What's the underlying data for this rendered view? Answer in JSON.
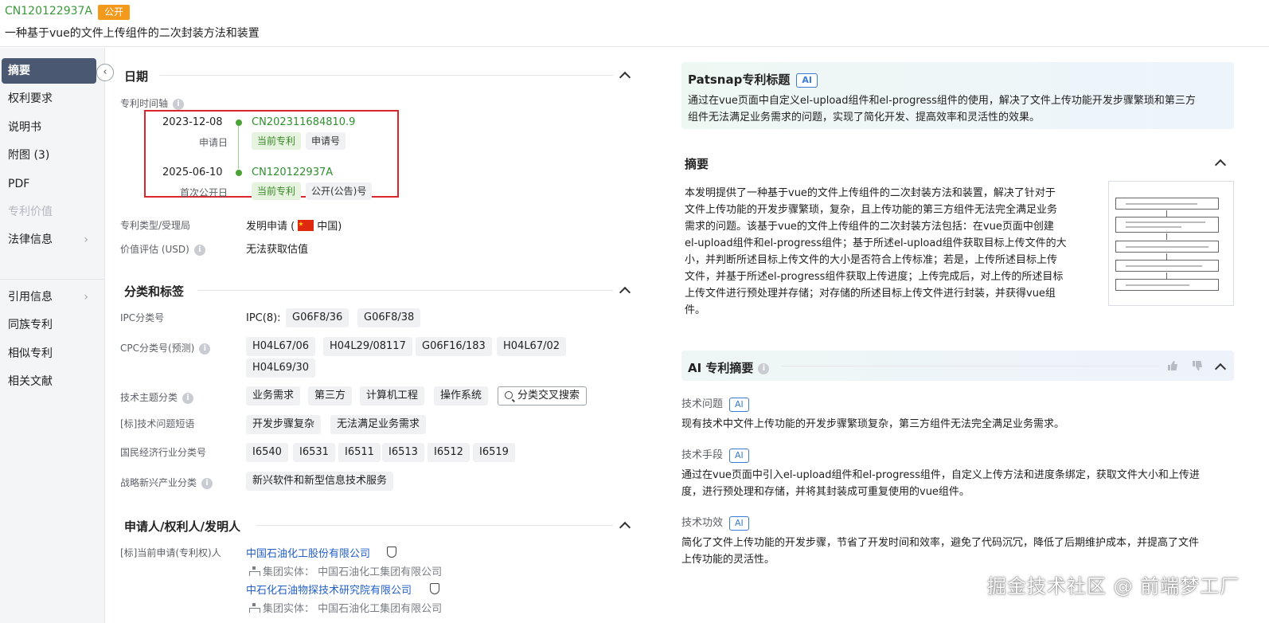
{
  "header": {
    "pub_no": "CN120122937A",
    "status_badge": "公开",
    "title": "一种基于vue的文件上传组件的二次封装方法和装置"
  },
  "sidebar": {
    "items": [
      {
        "label": "摘要",
        "state": "active"
      },
      {
        "label": "权利要求"
      },
      {
        "label": "说明书"
      },
      {
        "label": "附图 (3)"
      },
      {
        "label": "PDF"
      },
      {
        "label": "专利价值",
        "state": "disabled"
      },
      {
        "label": "法律信息",
        "has_arrow": true
      },
      {
        "label": "引用信息",
        "has_arrow": true
      },
      {
        "label": "同族专利"
      },
      {
        "label": "相似专利"
      },
      {
        "label": "相关文献"
      }
    ],
    "chevron": "›",
    "collapse_glyph": "‹"
  },
  "dates": {
    "section_title": "日期",
    "timeline_label": "专利时间轴",
    "entries": [
      {
        "date": "2023-12-08",
        "sub": "申请日",
        "number": "CN202311684810.9",
        "tag1": "当前专利",
        "tag2": "申请号"
      },
      {
        "date": "2025-06-10",
        "sub": "首次公开日",
        "number": "CN120122937A",
        "tag1": "当前专利",
        "tag2": "公开(公告)号"
      }
    ],
    "type_label": "专利类型/受理局",
    "type_value": "发明申请 (",
    "country": "中国)",
    "valuation_label": "价值评估 (USD)",
    "valuation_value": "无法获取估值"
  },
  "classification": {
    "section_title": "分类和标签",
    "ipc_label": "IPC分类号",
    "ipc_prefix": "IPC(8):",
    "ipc_tags": [
      "G06F8/36",
      "G06F8/38"
    ],
    "cpc_label": "CPC分类号(预测)",
    "cpc_tags": [
      "H04L67/06",
      "H04L29/08117",
      "G06F16/183",
      "H04L67/02",
      "H04L69/30"
    ],
    "topic_label": "技术主题分类",
    "topic_tags": [
      "业务需求",
      "第三方",
      "计算机工程",
      "操作系统"
    ],
    "cross_search": "分类交叉搜索",
    "problem_label": "[标]技术问题短语",
    "problem_tags": [
      "开发步骤复杂",
      "无法满足业务需求"
    ],
    "industry_label": "国民经济行业分类号",
    "industry_tags": [
      "I6540",
      "I6531",
      "I6511",
      "I6513",
      "I6512",
      "I6519"
    ],
    "strategic_label": "战略新兴产业分类",
    "strategic_tags": [
      "新兴软件和新型信息技术服务"
    ]
  },
  "applicants": {
    "section_title": "申请人/权利人/发明人",
    "current_label": "[标]当前申请(专利权)人",
    "companies": [
      {
        "name": "中国石油化工股份有限公司",
        "group": "集团实体：  中国石油化工集团有限公司"
      },
      {
        "name": "中石化石油物探技术研究院有限公司",
        "group": "集团实体：  中国石油化工集团有限公司"
      }
    ]
  },
  "patsnap_title": {
    "heading": "Patsnap专利标题",
    "ai_chip": "AI",
    "text_line1": "通过在vue页面中自定义el-upload组件和el-progress组件的使用，解决了文件上传功能开发步骤繁琐和第三方",
    "text_line2": "组件无法满足业务需求的问题，实现了简化开发、提高效率和灵活性的效果。"
  },
  "abstract": {
    "heading": "摘要",
    "lines": [
      "本发明提供了一种基于vue的文件上传组件的二次封装方法和装置，解决了针对于",
      "文件上传功能的开发步骤繁琐，复杂，且上传功能的第三方组件无法完全满足业务",
      "需求的问题。该基于vue的文件上传组件的二次封装方法包括：在vue页面中创建",
      "el-upload组件和el-progress组件；基于所述el-upload组件获取目标上传文件的大",
      "小，并判断所述目标上传文件的大小是否符合上传标准；若是，上传所述目标上传",
      "文件，并基于所述el-progress组件获取上传进度；上传完成后，对上传的所述目标",
      "上传文件进行预处理并存储；对存储的所述目标上传文件进行封装，并获得vue组",
      "件。"
    ]
  },
  "ai_summary": {
    "heading": "AI 专利摘要",
    "problem_label": "技术问题",
    "problem_text": "现有技术中文件上传功能的开发步骤繁琐复杂，第三方组件无法完全满足业务需求。",
    "means_label": "技术手段",
    "means_line1": "通过在vue页面中引入el-upload组件和el-progress组件，自定义上传方法和进度条绑定，获取文件大小和上传进",
    "means_line2": "度，进行预处理和存储，并将其封装成可重复使用的vue组件。",
    "effect_label": "技术功效",
    "effect_line1": "简化了文件上传功能的开发步骤，节省了开发时间和效率，避免了代码沉冗，降低了后期维护成本，并提高了文件",
    "effect_line2": "上传功能的灵活性。",
    "ai_chip": "AI"
  },
  "watermark": "掘金技术社区 @ 前端梦工厂",
  "colors": {
    "accent_green": "#3a9a3a",
    "badge_orange": "#f39a1d",
    "sidebar_active": "#4a5871",
    "link_blue": "#2460c8",
    "highlight_red": "#d8262c"
  }
}
